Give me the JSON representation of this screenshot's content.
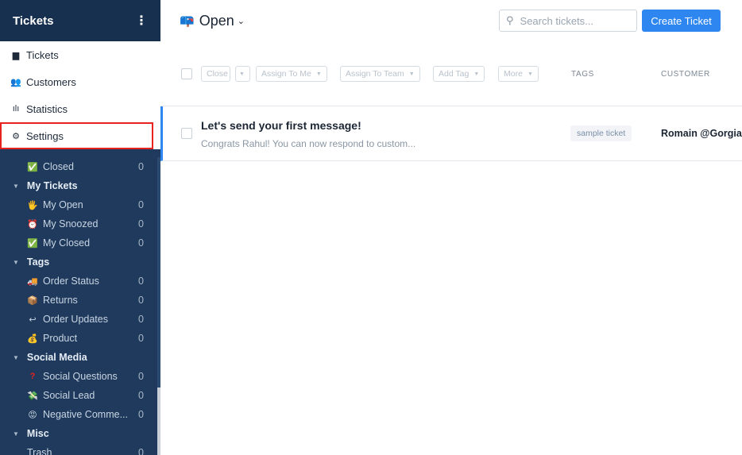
{
  "sidebar": {
    "title": "Tickets",
    "menu": [
      {
        "label": "Tickets",
        "icon": "chat-icon"
      },
      {
        "label": "Customers",
        "icon": "people-icon"
      },
      {
        "label": "Statistics",
        "icon": "bar-chart-icon"
      },
      {
        "label": "Settings",
        "icon": "gear-icon"
      }
    ],
    "views": {
      "closed": {
        "label": "Closed",
        "count": "0"
      },
      "my_tickets": {
        "label": "My Tickets",
        "items": [
          {
            "label": "My Open",
            "count": "0"
          },
          {
            "label": "My Snoozed",
            "count": "0"
          },
          {
            "label": "My Closed",
            "count": "0"
          }
        ]
      },
      "tags": {
        "label": "Tags",
        "items": [
          {
            "label": "Order Status",
            "count": "0"
          },
          {
            "label": "Returns",
            "count": "0"
          },
          {
            "label": "Order Updates",
            "count": "0"
          },
          {
            "label": "Product",
            "count": "0"
          }
        ]
      },
      "social_media": {
        "label": "Social Media",
        "items": [
          {
            "label": "Social Questions",
            "count": "0"
          },
          {
            "label": "Social Lead",
            "count": "0"
          },
          {
            "label": "Negative Comme...",
            "count": "0"
          }
        ]
      },
      "misc": {
        "label": "Misc",
        "items": [
          {
            "label": "Trash",
            "count": "0"
          }
        ]
      }
    }
  },
  "main": {
    "view_title": "Open",
    "search_placeholder": "Search tickets...",
    "create_button": "Create Ticket",
    "toolbar": {
      "close": "Close",
      "assign_me": "Assign To Me",
      "assign_team": "Assign To Team",
      "add_tag": "Add Tag",
      "more": "More"
    },
    "columns": {
      "tags": "TAGS",
      "customer": "CUSTOMER"
    },
    "tickets": [
      {
        "subject": "Let's send your first message!",
        "preview": "Congrats Rahul! You can now respond to custom...",
        "tag": "sample ticket",
        "customer": "Romain @Gorgias"
      }
    ]
  },
  "colors": {
    "sidebar_bg": "#1f3a5c",
    "accent": "#2e87f0",
    "highlight": "#e8221f"
  }
}
